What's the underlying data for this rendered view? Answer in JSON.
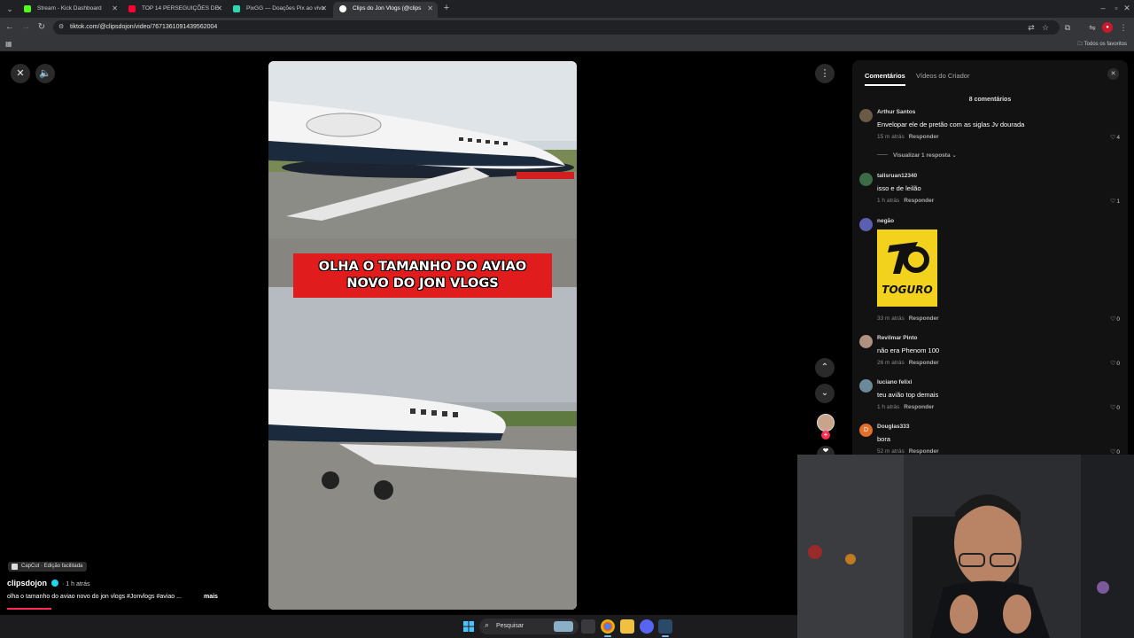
{
  "browser": {
    "tabs": [
      {
        "title": "Stream - Kick Dashboard",
        "color": "#53fc18",
        "active": false
      },
      {
        "title": "TOP 14 PERSEGUIÇÕES DE 1",
        "color": "#ff0033",
        "active": false
      },
      {
        "title": "PixGG — Doações Pix ao vivo p",
        "color": "#2bd9b0",
        "active": false
      },
      {
        "title": "Clips do Jon Vlogs (@clips",
        "color": "#ffffff",
        "active": true
      }
    ],
    "url": "tiktok.com/@clipsdojon/video/7671361091439562004",
    "bookmarks_folder": "Todos os favoritos"
  },
  "video": {
    "caption": "OLHA O TAMANHO DO AVIAO NOVO DO JON VLOGS",
    "capcut_label": "CapCut · Edição facilitada",
    "author": "clipsdojon",
    "posted": "· 1 h atrás",
    "description": "olha o tamanho do aviao novo do jon vlogs #Jonvlogs #aviao ...",
    "more_label": "mais"
  },
  "panel": {
    "tabs": [
      "Comentários",
      "Vídeos do Criador"
    ],
    "count_label": "8 comentários",
    "reply_label": "Responder",
    "comments": [
      {
        "user": "Arthur Santos",
        "text": "Envelopar ele de pretão com as siglas Jv dourada",
        "time": "15 m atrás",
        "likes": "4",
        "avatar_color": "#6b5a45",
        "replies": "Visualizar 1 resposta"
      },
      {
        "user": "talisruan12340",
        "text": "isso e de leilão",
        "time": "1 h atrás",
        "likes": "1",
        "avatar_color": "#3d6b45"
      },
      {
        "user": "negão",
        "text": "",
        "time": "33 m atrás",
        "likes": "0",
        "avatar_color": "#5b5fb0",
        "sticker": "TOGURO"
      },
      {
        "user": "Revilmar Pinto",
        "text": "não era Phenom 100",
        "time": "26 m atrás",
        "likes": "0",
        "avatar_color": "#b09080"
      },
      {
        "user": "luciano felixi",
        "text": "teu avião top demais",
        "time": "1 h atrás",
        "likes": "0",
        "avatar_color": "#6a8a9a"
      },
      {
        "user": "Douglas333",
        "text": "bora",
        "time": "52 m atrás",
        "likes": "0",
        "avatar_color": "#e0702a",
        "initial": "D"
      }
    ]
  },
  "taskbar": {
    "search_placeholder": "Pesquisar"
  }
}
